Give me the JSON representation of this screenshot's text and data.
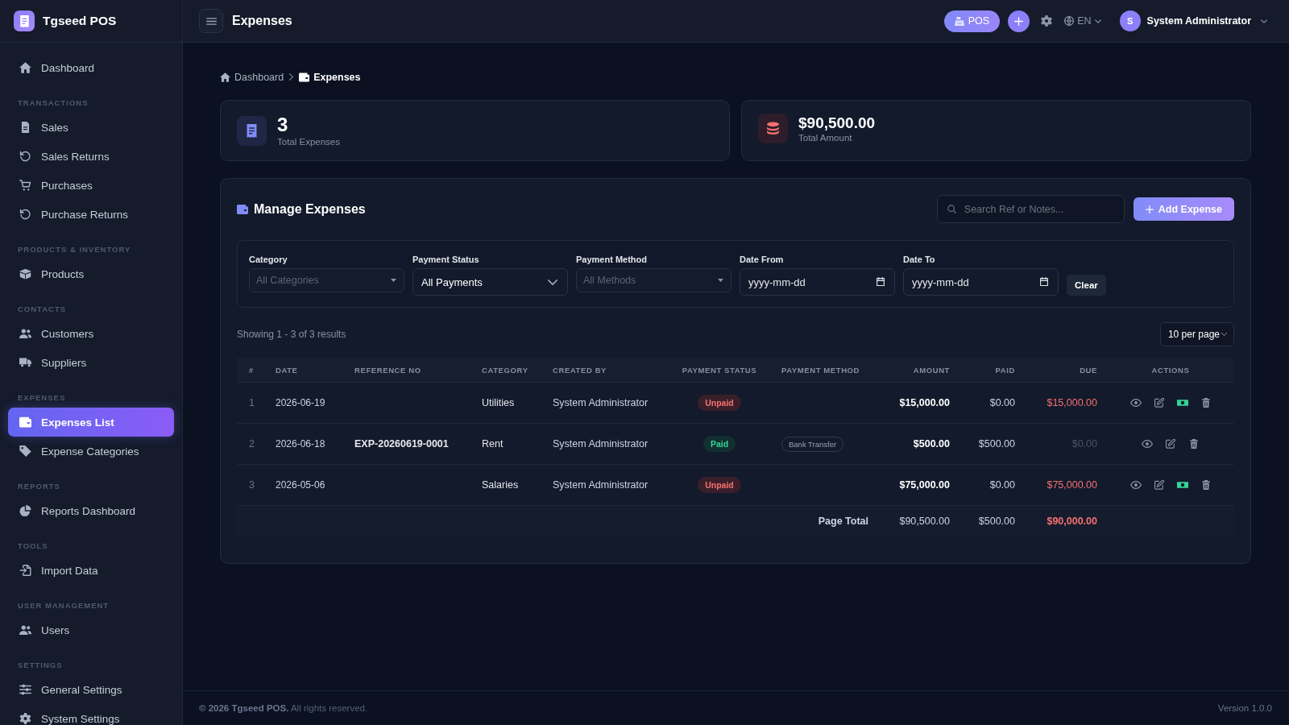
{
  "app": {
    "name": "Tgseed POS"
  },
  "sidebar": {
    "groups": [
      {
        "items": [
          {
            "label": "Dashboard",
            "selected": false
          }
        ]
      },
      {
        "heading": "TRANSACTIONS",
        "items": [
          {
            "label": "Sales",
            "selected": false
          },
          {
            "label": "Sales Returns",
            "selected": false
          },
          {
            "label": "Purchases",
            "selected": false
          },
          {
            "label": "Purchase Returns",
            "selected": false
          }
        ]
      },
      {
        "heading": "PRODUCTS & INVENTORY",
        "items": [
          {
            "label": "Products",
            "selected": false
          }
        ]
      },
      {
        "heading": "CONTACTS",
        "items": [
          {
            "label": "Customers",
            "selected": false
          },
          {
            "label": "Suppliers",
            "selected": false
          }
        ]
      },
      {
        "heading": "EXPENSES",
        "items": [
          {
            "label": "Expenses List",
            "selected": true
          },
          {
            "label": "Expense Categories",
            "selected": false
          }
        ]
      },
      {
        "heading": "REPORTS",
        "items": [
          {
            "label": "Reports Dashboard",
            "selected": false
          }
        ]
      },
      {
        "heading": "TOOLS",
        "items": [
          {
            "label": "Import Data",
            "selected": false
          }
        ]
      },
      {
        "heading": "USER MANAGEMENT",
        "items": [
          {
            "label": "Users",
            "selected": false
          }
        ]
      },
      {
        "heading": "SETTINGS",
        "items": [
          {
            "label": "General Settings",
            "selected": false
          },
          {
            "label": "System Settings",
            "selected": false
          }
        ]
      }
    ]
  },
  "topbar": {
    "title": "Expenses",
    "pos_button": "POS",
    "language": "EN",
    "user": {
      "initial": "S",
      "name": "System Administrator"
    }
  },
  "breadcrumb": [
    {
      "label": "Dashboard",
      "current": false
    },
    {
      "label": "Expenses",
      "current": true
    }
  ],
  "stats": [
    {
      "kind": "count",
      "value": "3",
      "label": "Total Expenses"
    },
    {
      "kind": "amount",
      "value": "$90,500.00",
      "label": "Total Amount"
    }
  ],
  "panel": {
    "title": "Manage Expenses",
    "search": {
      "placeholder": "Search Ref or Notes..."
    },
    "add_button": "Add Expense",
    "filters": [
      {
        "kind": "select",
        "label": "Category",
        "placeholder": "All Categories"
      },
      {
        "kind": "dropdown",
        "label": "Payment Status",
        "value": "All Payments"
      },
      {
        "kind": "select",
        "label": "Payment Method",
        "placeholder": "All Methods"
      },
      {
        "kind": "date",
        "label": "Date From",
        "placeholder": "yyyy-mm-dd"
      },
      {
        "kind": "date",
        "label": "Date To",
        "placeholder": "yyyy-mm-dd"
      }
    ],
    "clear_button": "Clear",
    "summary": "Showing 1 - 3 of 3 results",
    "per_page": "10 per page",
    "table": {
      "columns": [
        {
          "label": "#"
        },
        {
          "label": "DATE"
        },
        {
          "label": "REFERENCE NO"
        },
        {
          "label": "CATEGORY"
        },
        {
          "label": "CREATED BY"
        },
        {
          "label": "PAYMENT STATUS"
        },
        {
          "label": "PAYMENT METHOD"
        },
        {
          "label": "AMOUNT"
        },
        {
          "label": "PAID"
        },
        {
          "label": "DUE"
        },
        {
          "label": "ACTIONS"
        }
      ],
      "rows": [
        {
          "number": "1",
          "date": "2026-06-19",
          "category": "Utilities",
          "created_by": "System Administrator",
          "payment_status": {
            "kind": "unpaid",
            "label": "Unpaid"
          },
          "amount": "$15,000.00",
          "paid": "$0.00",
          "due": "$15,000.00",
          "actions": [
            {
              "kind": "view"
            },
            {
              "kind": "edit"
            },
            {
              "kind": "pay"
            },
            {
              "kind": "delete"
            }
          ]
        },
        {
          "number": "2",
          "date": "2026-06-18",
          "reference": "EXP-20260619-0001",
          "category": "Rent",
          "created_by": "System Administrator",
          "payment_status": {
            "kind": "paid",
            "label": "Paid"
          },
          "payment_method": "Bank Transfer",
          "amount": "$500.00",
          "paid": "$500.00",
          "due": "$0.00",
          "actions": [
            {
              "kind": "view"
            },
            {
              "kind": "edit"
            },
            {
              "kind": "delete"
            }
          ]
        },
        {
          "number": "3",
          "date": "2026-05-06",
          "category": "Salaries",
          "created_by": "System Administrator",
          "payment_status": {
            "kind": "unpaid",
            "label": "Unpaid"
          },
          "amount": "$75,000.00",
          "paid": "$0.00",
          "due": "$75,000.00",
          "actions": [
            {
              "kind": "view"
            },
            {
              "kind": "edit"
            },
            {
              "kind": "pay"
            },
            {
              "kind": "delete"
            }
          ]
        }
      ],
      "total": {
        "label": "Page Total",
        "amount": "$90,500.00",
        "paid": "$500.00",
        "due": "$90,000.00"
      }
    }
  },
  "footer": {
    "copyright": "**© 2026 Tgseed POS.** All rights reserved.",
    "version": "Version 1.0.0"
  }
}
